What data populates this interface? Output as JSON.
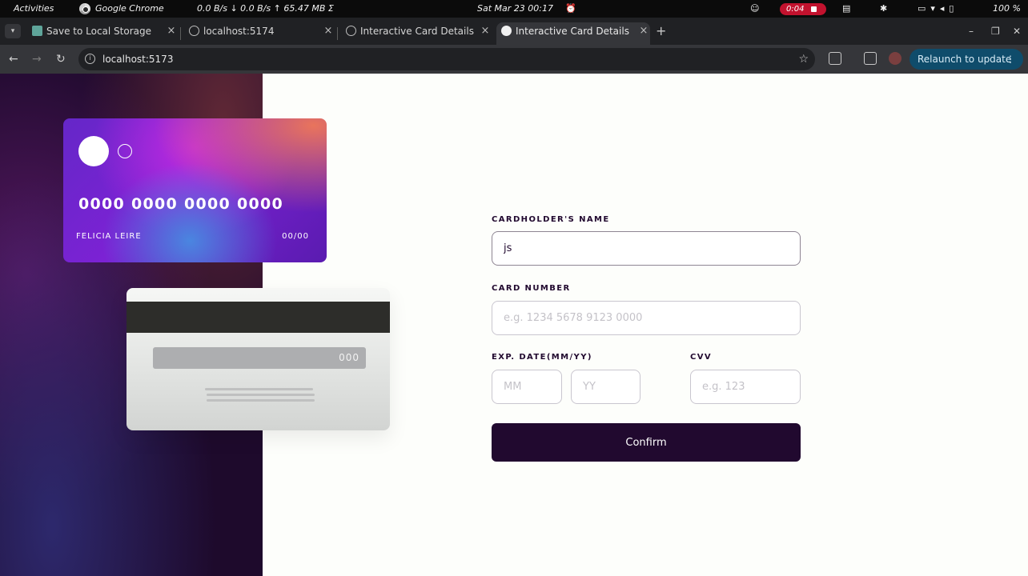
{
  "system_bar": {
    "activities": "Activities",
    "app_name": "Google Chrome",
    "network_stats": "0.0 B/s ↓   0.0 B/s ↑   65.47 MB Σ",
    "clock": "Sat Mar 23  00:17",
    "recording_time": "0:04",
    "battery": "100 %"
  },
  "tabs": [
    {
      "title": "Save to Local Storage",
      "active": false,
      "icon": "storage-icon"
    },
    {
      "title": "localhost:5174",
      "active": false,
      "icon": "globe-icon"
    },
    {
      "title": "Interactive Card Details",
      "active": false,
      "icon": "globe-icon"
    },
    {
      "title": "Interactive Card Details",
      "active": true,
      "icon": "page-icon"
    }
  ],
  "address_bar": {
    "url": "localhost:5173",
    "relaunch_label": "Relaunch to update"
  },
  "card_front": {
    "number": "0000 0000 0000 0000",
    "holder_name": "FELICIA LEIRE",
    "expiry": "00/00"
  },
  "card_back": {
    "cvc": "000"
  },
  "form": {
    "name_label": "CARDHOLDER'S NAME",
    "name_value": "js",
    "number_label": "CARD NUMBER",
    "number_placeholder": "e.g. 1234 5678 9123 0000",
    "expiry_label": "EXP. DATE(MM/YY)",
    "month_placeholder": "MM",
    "year_placeholder": "YY",
    "cvc_label": "CVV",
    "cvc_placeholder": "e.g. 123",
    "confirm_label": "Confirm"
  },
  "colors": {
    "accent": "#21092f",
    "relaunch_bg": "#0f4c6b",
    "recording": "#c2122e"
  }
}
